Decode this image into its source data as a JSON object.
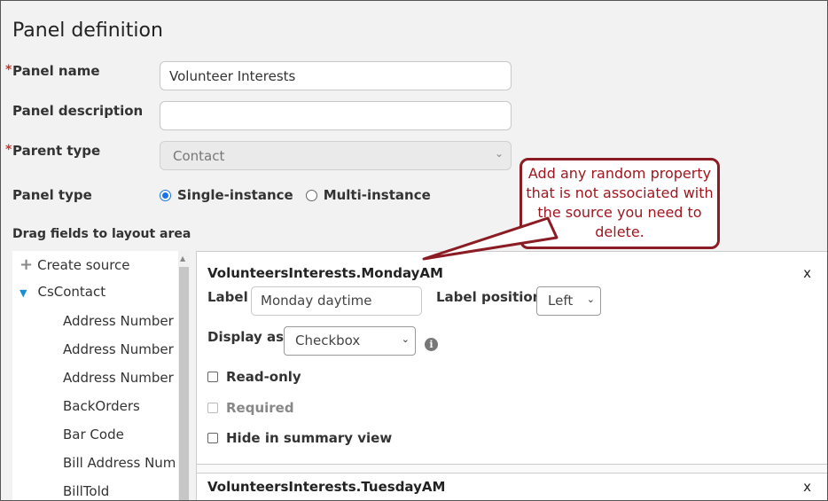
{
  "page": {
    "title": "Panel definition"
  },
  "form": {
    "panel_name": {
      "label": "Panel name",
      "required_mark": "*",
      "value": "Volunteer Interests"
    },
    "panel_description": {
      "label": "Panel description",
      "value": ""
    },
    "parent_type": {
      "label": "Parent type",
      "required_mark": "*",
      "value": "Contact",
      "disabled": true
    },
    "panel_type": {
      "label": "Panel type",
      "options": [
        "Single-instance",
        "Multi-instance"
      ],
      "selected": "Single-instance"
    }
  },
  "drag": {
    "label": "Drag fields to layout area"
  },
  "tree": {
    "create_source": "Create source",
    "group": "CsContact",
    "items": [
      "Address Number",
      "Address Number",
      "Address Number",
      "BackOrders",
      "Bar Code",
      "Bill Address Num",
      "BillTold"
    ]
  },
  "cards": [
    {
      "title": "VolunteersInterests.MondayAM",
      "close": "x",
      "label_label": "Label",
      "label_value": "Monday daytime",
      "label_position_label": "Label position",
      "label_position_value": "Left",
      "display_as_label": "Display as",
      "display_as_value": "Checkbox",
      "checkboxes": [
        {
          "label": "Read-only",
          "checked": false,
          "disabled": false
        },
        {
          "label": "Required",
          "checked": false,
          "disabled": true
        },
        {
          "label": "Hide in summary view",
          "checked": false,
          "disabled": false
        }
      ]
    },
    {
      "title": "VolunteersInterests.TuesdayAM",
      "close": "x"
    }
  ],
  "callout": {
    "text": "Add any random property that is not associated with the source you need to delete.",
    "color": "#a1151e",
    "border_color": "#8b1c24"
  },
  "colors": {
    "accent": "#1a73e8",
    "tree_arrow": "#1a8fd6",
    "required": "#c0392b"
  },
  "icons": {
    "radio_selected": "radio-selected-icon",
    "plus": "plus-icon",
    "expand": "triangle-down-icon",
    "info": "info-icon"
  }
}
